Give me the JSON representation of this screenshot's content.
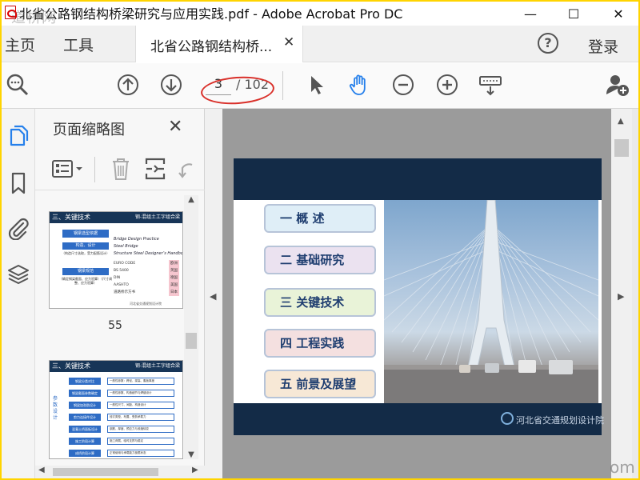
{
  "window": {
    "title": "北省公路钢结构桥梁研究与应用实践.pdf - Adobe Acrobat Pro DC",
    "controls": {
      "minimize": "—",
      "maximize": "☐",
      "close": "✕"
    }
  },
  "menu": {
    "home": "主页",
    "tools": "工具",
    "doc_tab": "北省公路钢结构桥...",
    "doc_tab_close": "✕",
    "help": "?",
    "login": "登录"
  },
  "toolbar": {
    "current_page": "3",
    "total_pages": "/ 102"
  },
  "thumbnails": {
    "panel_title": "页面缩略图",
    "close": "✕",
    "items": [
      {
        "page_label": "55",
        "header_left": "三、关键技术",
        "header_right": "钢-混组土工字组合梁",
        "left_boxes": [
          "钢梁选型依据",
          "构造、设计",
          "（构造尺寸选取，受力配筋设计）",
          "钢梁规范",
          "（确定钢梁截面、应力验算）（尺寸调整、应力验算）"
        ],
        "right_titles": [
          "Bridge Design Practice",
          "Steel Bridge",
          "Structure Steel Designer’s Handbook"
        ],
        "codes": [
          "EURO CODE",
          "BS 5400",
          "DIN",
          "AASHTO",
          "道路桥示方书"
        ],
        "countries": [
          "欧洲",
          "英国",
          "德国",
          "美国",
          "日本"
        ],
        "footer": "河北省交通规划设计院"
      },
      {
        "header_left": "三、关键技术",
        "header_right": "钢-混组土工字组合梁",
        "side_label": "参数设计",
        "steps": [
          "钢梁分类对比",
          "钢梁截面参数确定",
          "钢梁加劲肋设计",
          "剪力连接件设计",
          "混凝土桥面板设计",
          "施工阶段计算",
          "成桥阶段计算"
        ],
        "notes": [
          "一般性参数：跨径、梁高、腹板厚度",
          "一般性参数、构造细节与焊缝设计",
          "一般性尺寸、间距、构造设计",
          "栓钉类型、布置、受剪承载力",
          "钢筋、厚度、预应力与收缩徐变",
          "施工荷载、临时支撑与稳定",
          "正常使用与承载能力极限状态"
        ]
      }
    ]
  },
  "document": {
    "toc": [
      {
        "label": "一  概    述",
        "bg": "#dfeef7"
      },
      {
        "label": "二  基础研究",
        "bg": "#ebe2f0"
      },
      {
        "label": "三  关键技术",
        "bg": "#e9f3d8"
      },
      {
        "label": "四  工程实践",
        "bg": "#f4e0e0"
      },
      {
        "label": "五  前景及展望",
        "bg": "#f7e8d6"
      }
    ],
    "logo_text": "河北省交通规划设计院"
  },
  "colors": {
    "acrobat_blue": "#2680eb",
    "slide_navy": "#132b47",
    "annotation_red": "#d9302a",
    "frame_yellow": "#ffd400"
  },
  "watermark": {
    "top_left": "道桥网",
    "bottom_right": "om"
  }
}
